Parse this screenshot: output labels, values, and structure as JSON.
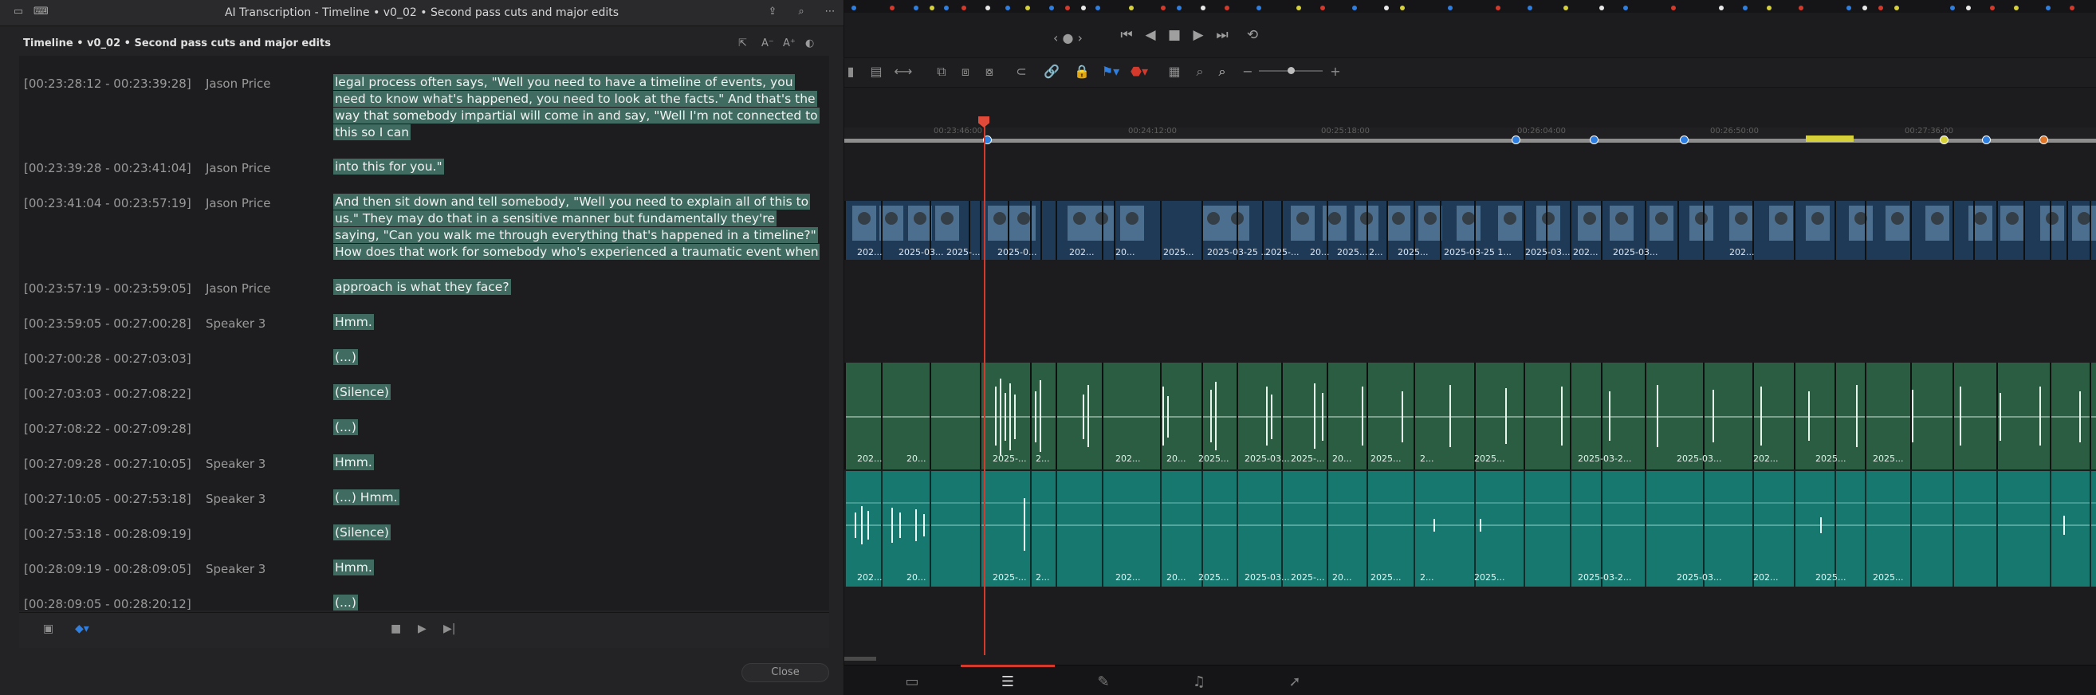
{
  "window": {
    "title": "AI Transcription - Timeline • v0_02 • Second pass cuts and major edits",
    "panel_title": "Timeline • v0_02 • Second pass cuts and major edits"
  },
  "icons": {
    "titlebar_left": [
      "sidebar-toggle-icon",
      "keyboard-icon"
    ],
    "titlebar_right": [
      "share-icon",
      "search-icon",
      "more-icon"
    ],
    "panel_tools": [
      "crop-icon",
      "text-smaller-icon",
      "text-larger-icon",
      "contrast-icon"
    ],
    "footer": [
      "clip-icon",
      "marker-color-icon",
      "stop-icon",
      "play-icon",
      "play-to-end-icon"
    ]
  },
  "rows": [
    {
      "timecode": "[00:23:28:12 - 00:23:39:28]",
      "speaker": "Jason Price",
      "text": "legal process often says, \"Well you need to have a timeline of events, you need to know what's happened, you need to look at the facts.\" And that's the way that somebody impartial will come in and say, \"Well I'm not connected to this so I can"
    },
    {
      "timecode": "[00:23:39:28 - 00:23:41:04]",
      "speaker": "Jason Price",
      "text": "into this for you.\""
    },
    {
      "timecode": "[00:23:41:04 - 00:23:57:19]",
      "speaker": "Jason Price",
      "text": "And then sit down and tell somebody, \"Well you need to explain all of this to us.\" They may do that in a sensitive manner but fundamentally they're saying, \"Can you walk me through everything that's happened in a timeline?\" How does that work for somebody who's experienced a traumatic event when that"
    },
    {
      "timecode": "[00:23:57:19 - 00:23:59:05]",
      "speaker": "Jason Price",
      "text": "approach is what they face?"
    },
    {
      "timecode": "[00:23:59:05 - 00:27:00:28]",
      "speaker": "Speaker 3",
      "text": "Hmm."
    },
    {
      "timecode": "[00:27:00:28 - 00:27:03:03]",
      "speaker": "",
      "text": "(...)"
    },
    {
      "timecode": "[00:27:03:03 - 00:27:08:22]",
      "speaker": "",
      "text": "(Silence)"
    },
    {
      "timecode": "[00:27:08:22 - 00:27:09:28]",
      "speaker": "",
      "text": "(...)"
    },
    {
      "timecode": "[00:27:09:28 - 00:27:10:05]",
      "speaker": "Speaker 3",
      "text": "Hmm."
    },
    {
      "timecode": "[00:27:10:05 - 00:27:53:18]",
      "speaker": "Speaker 3",
      "text": "(...) Hmm."
    },
    {
      "timecode": "[00:27:53:18 - 00:28:09:19]",
      "speaker": "",
      "text": "(Silence)"
    },
    {
      "timecode": "[00:28:09:19 - 00:28:09:05]",
      "speaker": "Speaker 3",
      "text": "Hmm."
    },
    {
      "timecode": "[00:28:09:05 - 00:28:20:12]",
      "speaker": "",
      "text": "(...)"
    }
  ],
  "close_label": "Close",
  "timeline": {
    "ruler_labels": [
      "00:23:46:00",
      "00:24:12:00",
      "00:25:18:00",
      "00:26:04:00",
      "00:26:50:00",
      "00:27:36:00"
    ],
    "video_clip_labels": [
      "202...",
      "2025-03...",
      "2025-...",
      "2025-0...",
      "202...",
      "20...",
      "2025...",
      "2025-03-25 ...",
      "2025-...",
      "20...",
      "2025...",
      "2...",
      "2025...",
      "2025-03-25 1...",
      "2025-03...",
      "202...",
      "2025-03...",
      "202..."
    ],
    "audio1_clip_labels": [
      "202...",
      "20...",
      "2025-...",
      "2...",
      "202...",
      "20...",
      "2025...",
      "2025-03...",
      "2025-...",
      "20...",
      "2025...",
      "2...",
      "2025...",
      "2025-03-2...",
      "2025-03...",
      "202...",
      "2025...",
      "2025..."
    ],
    "audio2_clip_labels": [
      "202...",
      "20...",
      "2025-...",
      "2...",
      "202...",
      "20...",
      "2025...",
      "2025-03...",
      "2025-...",
      "20...",
      "2025...",
      "2...",
      "2025...",
      "2025-03-2...",
      "2025-03...",
      "202...",
      "2025...",
      "2025..."
    ],
    "page_icons": [
      "media-page-icon",
      "edit-page-icon",
      "fusion-page-icon",
      "fairlight-page-icon",
      "deliver-page-icon"
    ],
    "transport_icons": [
      "first-frame-icon",
      "prev-frame-icon",
      "stop-icon",
      "play-icon",
      "next-frame-icon",
      "loop-icon"
    ]
  },
  "colors": {
    "highlight": "#3f6b60",
    "playhead": "#d33a2c",
    "video_track": "#1f3a57",
    "audio_track_1": "#2b5d43",
    "audio_track_2": "#16786f"
  }
}
